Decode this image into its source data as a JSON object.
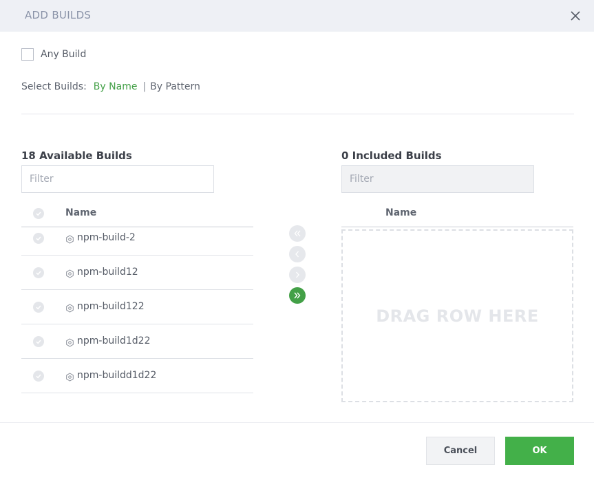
{
  "dialog": {
    "title": "ADD BUILDS"
  },
  "any_build": {
    "label": "Any Build",
    "checked": false
  },
  "select_builds": {
    "label": "Select Builds:",
    "by_name": "By Name",
    "separator": "|",
    "by_pattern": "By Pattern",
    "active": "By Name"
  },
  "available": {
    "title": "18 Available Builds",
    "filter_placeholder": "Filter",
    "column_name": "Name",
    "rows": [
      "npm-build-2",
      "npm-build12",
      "npm-build122",
      "npm-build1d22",
      "npm-buildd1d22"
    ]
  },
  "included": {
    "title": "0 Included Builds",
    "filter_placeholder": "Filter",
    "column_name": "Name",
    "drop_text": "DRAG ROW HERE"
  },
  "transfer": {
    "icons": [
      "double-chevron-left-icon",
      "chevron-left-icon",
      "chevron-right-icon",
      "double-chevron-right-icon"
    ],
    "enabled": [
      false,
      false,
      false,
      true
    ]
  },
  "buttons": {
    "cancel": "Cancel",
    "ok": "OK"
  },
  "colors": {
    "accent": "#43a047",
    "ok_button": "#43b049",
    "header_bg": "#eef0f5"
  }
}
